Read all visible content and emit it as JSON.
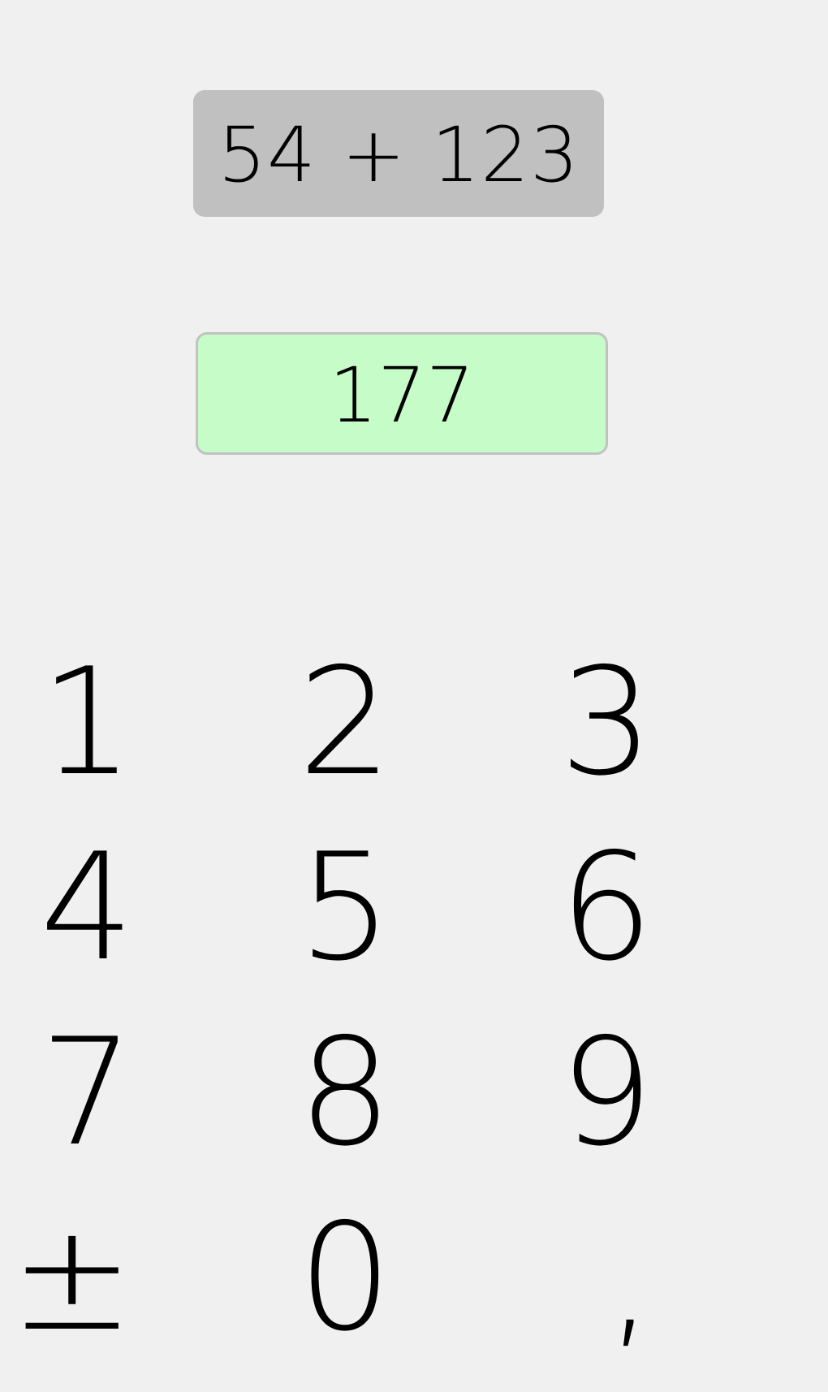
{
  "problem": {
    "expression": "54 + 123"
  },
  "answer": {
    "value": "177",
    "status_color": "#c6fcc7"
  },
  "keypad": {
    "keys": [
      "1",
      "2",
      "3",
      "4",
      "5",
      "6",
      "7",
      "8",
      "9",
      "±",
      "0",
      ","
    ]
  }
}
